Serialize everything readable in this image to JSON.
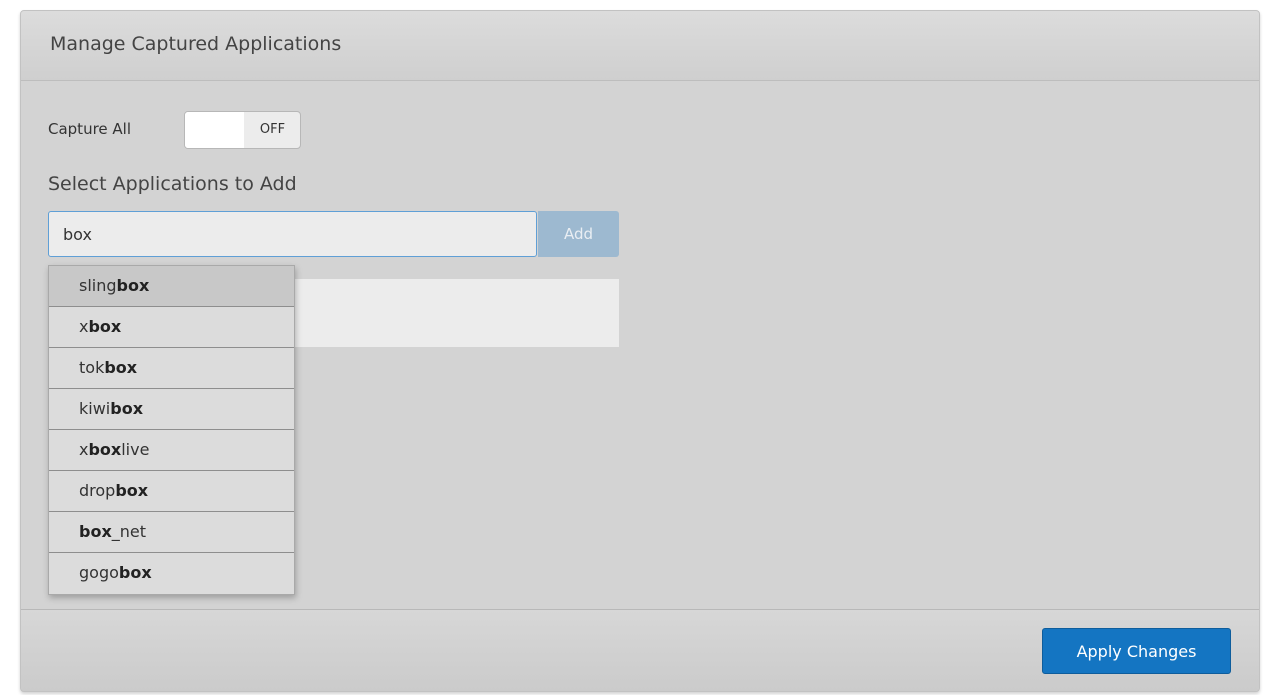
{
  "panel": {
    "title": "Manage Captured Applications"
  },
  "capture_all": {
    "label": "Capture All",
    "state": "OFF"
  },
  "select": {
    "label": "Select Applications to Add",
    "input_value": "box",
    "add_label": "Add"
  },
  "suggestions": [
    {
      "pre": "sling",
      "match": "box",
      "post": ""
    },
    {
      "pre": "x",
      "match": "box",
      "post": ""
    },
    {
      "pre": "tok",
      "match": "box",
      "post": ""
    },
    {
      "pre": "kiwi",
      "match": "box",
      "post": ""
    },
    {
      "pre": "x",
      "match": "box",
      "post": "live"
    },
    {
      "pre": "drop",
      "match": "box",
      "post": ""
    },
    {
      "pre": "",
      "match": "box",
      "post": "_net"
    },
    {
      "pre": "gogo",
      "match": "box",
      "post": ""
    }
  ],
  "footer": {
    "apply_label": "Apply Changes"
  },
  "colors": {
    "accent": "#1475c2",
    "input_focus_border": "#5f9fd6",
    "panel_bg": "#d3d3d3"
  }
}
